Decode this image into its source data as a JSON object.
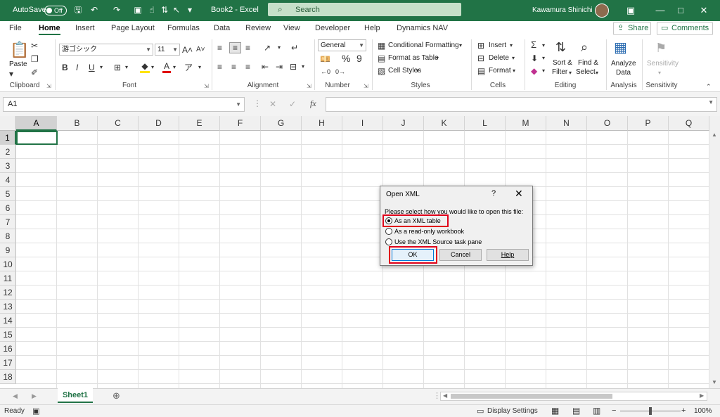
{
  "titlebar": {
    "autosave_label": "AutoSave",
    "autosave_state": "Off",
    "doc_title": "Book2 - Excel",
    "search_placeholder": "Search",
    "user_name": "Kawamura Shinichi"
  },
  "tabs": [
    "File",
    "Home",
    "Insert",
    "Page Layout",
    "Formulas",
    "Data",
    "Review",
    "View",
    "Developer",
    "Help",
    "Dynamics NAV"
  ],
  "active_tab": "Home",
  "share_label": "Share",
  "comments_label": "Comments",
  "ribbon": {
    "clipboard": {
      "paste": "Paste",
      "label": "Clipboard"
    },
    "font": {
      "name": "游ゴシック",
      "size": "11",
      "bold": "B",
      "italic": "I",
      "underline": "U",
      "label": "Font"
    },
    "alignment": {
      "label": "Alignment"
    },
    "number": {
      "format": "General",
      "percent": "%",
      "comma": "9",
      "label": "Number"
    },
    "styles": {
      "conditional": "Conditional Formatting",
      "format_table": "Format as Table",
      "cell_styles": "Cell Styles",
      "label": "Styles"
    },
    "cells": {
      "insert": "Insert",
      "delete": "Delete",
      "format": "Format",
      "label": "Cells"
    },
    "editing": {
      "sort1": "Sort &",
      "sort2": "Filter",
      "find1": "Find &",
      "find2": "Select",
      "label": "Editing"
    },
    "analysis": {
      "analyze1": "Analyze",
      "analyze2": "Data",
      "label": "Analysis"
    },
    "sensitivity": {
      "btn": "Sensitivity",
      "label": "Sensitivity"
    }
  },
  "formula_bar": {
    "name_box": "A1",
    "fx": "fx",
    "value": ""
  },
  "columns": [
    "A",
    "B",
    "C",
    "D",
    "E",
    "F",
    "G",
    "H",
    "I",
    "J",
    "K",
    "L",
    "M",
    "N",
    "O",
    "P",
    "Q"
  ],
  "rows": [
    "1",
    "2",
    "3",
    "4",
    "5",
    "6",
    "7",
    "8",
    "9",
    "10",
    "11",
    "12",
    "13",
    "14",
    "15",
    "16",
    "17",
    "18"
  ],
  "sheet_tab": "Sheet1",
  "status": {
    "ready": "Ready",
    "display_settings": "Display Settings",
    "zoom": "100%"
  },
  "dialog": {
    "title": "Open XML",
    "help_glyph": "?",
    "prompt": "Please select how you would like to open this file:",
    "options": [
      "As an XML table",
      "As a read-only workbook",
      "Use the XML Source task pane"
    ],
    "selected_index": 0,
    "ok": "OK",
    "cancel": "Cancel",
    "help": "Help"
  },
  "colors": {
    "excel_green": "#217346",
    "highlight_red": "#e0001a"
  }
}
